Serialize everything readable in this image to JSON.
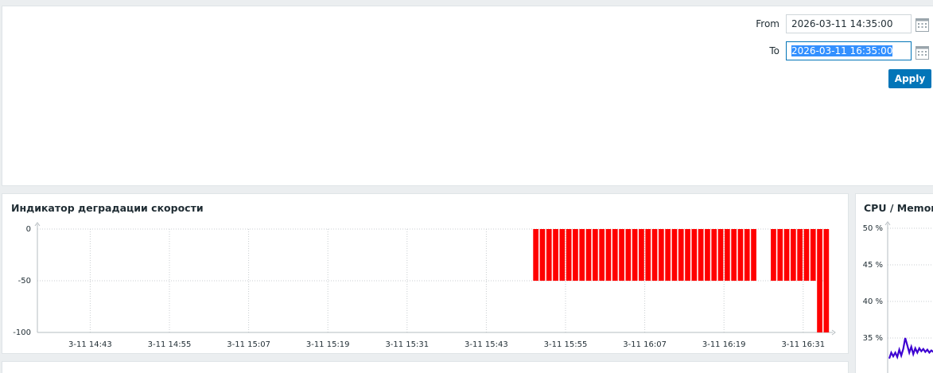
{
  "filter": {
    "from_label": "From",
    "from_value": "2026-03-11 14:35:00",
    "to_label": "To",
    "to_value": "2026-03-11 16:35:00",
    "apply_label": "Apply",
    "calendar_icon": "calendar-icon"
  },
  "widgets": {
    "degradation_title": "Индикатор деградации скорости",
    "cpu_title": "CPU / Memor"
  },
  "colors": {
    "accent": "#0275b8",
    "bar": "#ff0000",
    "cpu_line": "#3d00d1"
  },
  "chart_data": [
    {
      "type": "bar",
      "title": "Индикатор деградации скорости",
      "ylim": [
        -100,
        0
      ],
      "y_ticks": [
        "0",
        "-50",
        "-100"
      ],
      "x_ticks": [
        "3-11 14:43",
        "3-11 14:55",
        "3-11 15:07",
        "3-11 15:19",
        "3-11 15:31",
        "3-11 15:43",
        "3-11 15:55",
        "3-11 16:07",
        "3-11 16:19",
        "3-11 16:31"
      ],
      "x_tick_minutes": [
        8,
        20,
        32,
        44,
        56,
        68,
        80,
        92,
        104,
        116
      ],
      "x_range_minutes": [
        0,
        120
      ],
      "grid": true,
      "bars": {
        "minutes": [
          75,
          76,
          77,
          78,
          79,
          80,
          81,
          82,
          83,
          84,
          85,
          86,
          87,
          88,
          89,
          90,
          91,
          92,
          93,
          94,
          95,
          96,
          97,
          98,
          99,
          100,
          101,
          102,
          103,
          104,
          105,
          106,
          107,
          108,
          111,
          112,
          113,
          114,
          115,
          116,
          117,
          118,
          119
        ],
        "values": [
          -50,
          -50,
          -50,
          -50,
          -50,
          -50,
          -50,
          -50,
          -50,
          -50,
          -50,
          -50,
          -50,
          -50,
          -50,
          -50,
          -50,
          -50,
          -50,
          -50,
          -50,
          -50,
          -50,
          -50,
          -50,
          -50,
          -50,
          -50,
          -50,
          -50,
          -50,
          -50,
          -50,
          -50,
          -50,
          -50,
          -50,
          -50,
          -50,
          -50,
          -50,
          -100,
          -100
        ]
      }
    },
    {
      "type": "line",
      "title": "CPU / Memor",
      "y_ticks": [
        "50 %",
        "45 %",
        "40 %",
        "35 %"
      ],
      "y_tick_values": [
        50,
        45,
        40,
        35
      ],
      "ylim": [
        34,
        50
      ],
      "grid": true,
      "series": [
        {
          "values": [
            32.2,
            33.0,
            32.5,
            33.0,
            32.4,
            33.4,
            32.6,
            33.5,
            35.0,
            34.0,
            33.0,
            33.8,
            32.8,
            33.6,
            33.0,
            33.6,
            33.2,
            33.5,
            33.1,
            33.4,
            33.0,
            33.3,
            33.1,
            33.2,
            33.0,
            33.4,
            33.2,
            33.6
          ]
        }
      ]
    }
  ]
}
